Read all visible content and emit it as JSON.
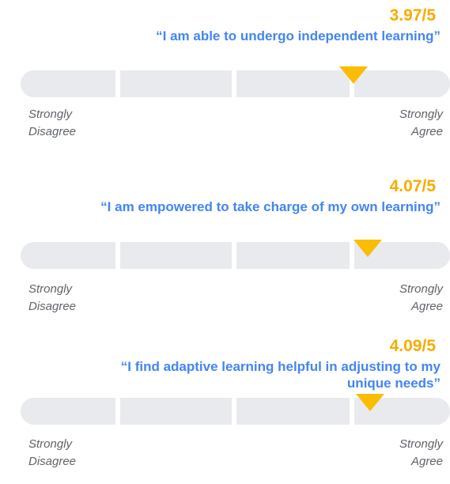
{
  "scale_labels": {
    "low": [
      "Strongly",
      "Disagree"
    ],
    "high": [
      "Strongly",
      "Agree"
    ]
  },
  "items": [
    {
      "score_text": "3.97/5",
      "score": 3.97,
      "max": 5,
      "statement": "“I am able to undergo independent learning”"
    },
    {
      "score_text": "4.07/5",
      "score": 4.07,
      "max": 5,
      "statement": "“I am empowered to take charge of my own learning”"
    },
    {
      "score_text": "4.09/5",
      "score": 4.09,
      "max": 5,
      "statement_lines": [
        "“I find adaptive learning helpful in adjusting to my",
        "unique needs”"
      ]
    }
  ],
  "colors": {
    "score": "#f9ab00",
    "statement": "#4285f4",
    "marker": "#fbbc04",
    "track": "#e8eaed",
    "scale_text": "#5f6368"
  }
}
